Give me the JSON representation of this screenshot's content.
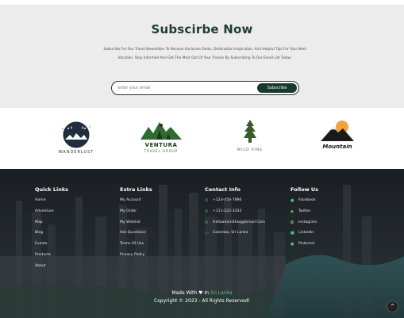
{
  "subscribe": {
    "title": "Subscirbe Now",
    "description": "Subscribe For Our Travel Newsletter To Receive Exclusive Deals, Destination Inspiration, And Helpful Tips For Your Next Vacation. Stay Informed And Get The Most Out Of Your Travels By Subscribing To Our Email List Today.",
    "email_placeholder": "enter your email",
    "button_label": "Subscribe"
  },
  "brands": [
    {
      "name": "WANDERLUST"
    },
    {
      "name": "VENTURA",
      "sub": "TRAVEL GROUP"
    },
    {
      "name": "WILD PINE"
    },
    {
      "name": "Mountain"
    }
  ],
  "footer": {
    "quick_links": {
      "title": "Quick Links",
      "items": [
        "Home",
        "Adventure",
        "Map",
        "Blog",
        "Events",
        "Products",
        "About"
      ]
    },
    "extra_links": {
      "title": "Extra Links",
      "items": [
        "My Account",
        "My Order",
        "My Wishlist",
        "Ask Questions",
        "Terms Of Use",
        "Privacy Policy"
      ]
    },
    "contact_info": {
      "title": "Contact Info",
      "items": [
        "+123-456-7890",
        "+111-222-3333",
        "Helloadamlthsq@Gmail.Com",
        "Colombo, Sri Lanka"
      ]
    },
    "follow_us": {
      "title": "Follow Us",
      "items": [
        "Facebook",
        "Twitter",
        "Instagram",
        "Linkedin",
        "Pinterest"
      ]
    },
    "credit_prefix": "Made With",
    "credit_in": "In",
    "credit_location": "Sri Lanka",
    "copyright": "Copyright © 2023 - All Rights Reserved!"
  },
  "colors": {
    "dark_green": "#163a2e",
    "accent_green": "#56c26a",
    "section_bg": "#ececec"
  }
}
